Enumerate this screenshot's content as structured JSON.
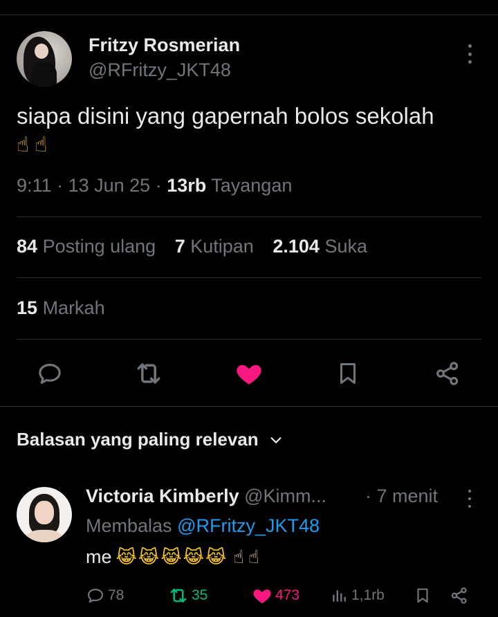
{
  "tweet": {
    "author_name": "Fritzy Rosmerian",
    "author_handle": "@RFritzy_JKT48",
    "text": "siapa disini yang gapernah bolos sekolah",
    "emoji": "☝☝",
    "time": "9:11",
    "date": "13 Jun 25",
    "views_count": "13rb",
    "views_label": "Tayangan"
  },
  "stats": {
    "reposts_count": "84",
    "reposts_label": "Posting ulang",
    "quotes_count": "7",
    "quotes_label": "Kutipan",
    "likes_count": "2.104",
    "likes_label": "Suka",
    "bookmarks_count": "15",
    "bookmarks_label": "Markah"
  },
  "actions": {
    "icons": [
      "reply-icon",
      "retweet-icon",
      "heart-icon",
      "bookmark-icon",
      "share-icon"
    ],
    "like_color": "#f91880"
  },
  "replies_sort": {
    "label": "Balasan yang paling relevan"
  },
  "reply": {
    "name": "Victoria Kimberly",
    "handle": "@Kimm...",
    "time": "· 7 menit",
    "replying_prefix": "Membalas",
    "replying_to": "@RFritzy_JKT48",
    "text": "me",
    "emoji_cats": "😹😹😹😹😹",
    "emoji_hands": "☝☝",
    "reply_count": "78",
    "retweet_count": "35",
    "like_count": "473",
    "views_count": "1,1rb"
  },
  "colors": {
    "background": "#000000",
    "text": "#e7e9ea",
    "muted": "#71767b",
    "link": "#1d9bf0",
    "retweet": "#00ba7c",
    "like": "#f91880",
    "divider": "#2f3336"
  }
}
